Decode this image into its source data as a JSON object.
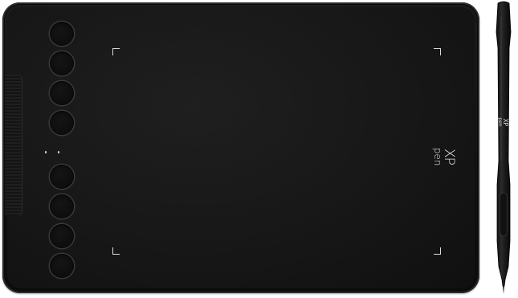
{
  "product": {
    "tablet": {
      "express_keys": 8,
      "logo_top": "XP",
      "logo_bottom": "pen"
    },
    "pen": {
      "logo_top": "XP",
      "logo_bottom": "pen"
    }
  },
  "colors": {
    "body": "#141414",
    "edge": "#2a2a2a",
    "marks": "#dcdcdc"
  }
}
